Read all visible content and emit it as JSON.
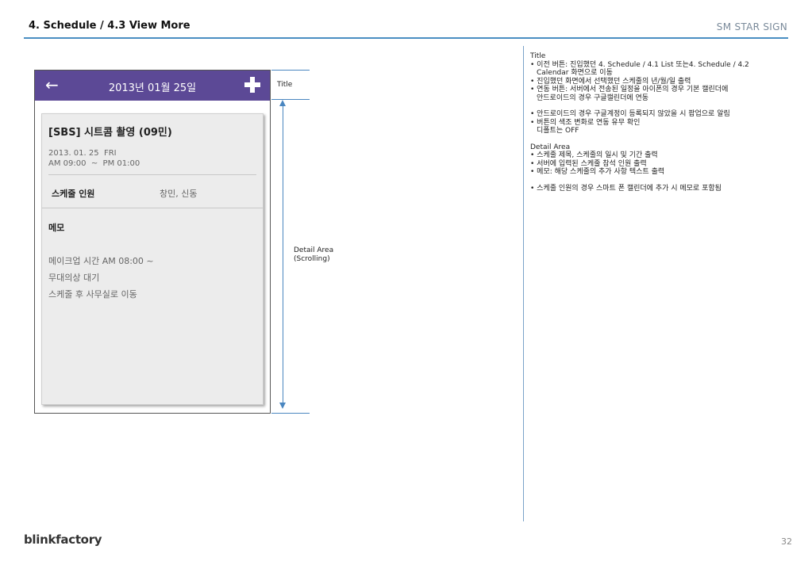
{
  "document": {
    "title": "4. Schedule / 4.3 View More",
    "brand": "SM STAR SIGN",
    "footer_logo": "blinkfactory",
    "page_number": "32"
  },
  "app": {
    "header": {
      "date": "2013년 01월 25일",
      "back_icon": "arrow-left-icon",
      "add_icon": "plus-icon"
    },
    "schedule": {
      "title": "[SBS] 시트콤 촬영 (09민)",
      "date_line": "2013. 01. 25  FRI",
      "time_line": "AM 09:00  ~  PM 01:00",
      "members_label": "스케줄 인원",
      "members_value": "창민, 신동",
      "memo_label": "메모",
      "memo_lines": [
        "메이크업 시간  AM 08:00 ~",
        "무대의상 대기",
        "스케줄 후 사무실로 이동"
      ]
    },
    "colors": {
      "header_bg": "#5c4996",
      "accent": "#4a8ec2"
    }
  },
  "annotations": {
    "title_label": "Title",
    "detail_label_1": "Detail Area",
    "detail_label_2": "(Scrolling)"
  },
  "notes": {
    "title_section": "Title",
    "b1": "• 이전 버튼: 진입했던  4. Schedule / 4.1 List 또는4. Schedule / 4.2",
    "b1_cont": "Calendar 화면으로 이동",
    "b2": "• 진입했던 화면에서 선택했던 스케줄의 년/월/일 출력",
    "b3": "• 연동 버튼: 서버에서 전송된 일정을 아이폰의 경우 기본 캘린더에",
    "b3_cont": "안드로이드의 경우 구글캘린더에 연동",
    "b4": "• 안드로이드의 경우 구글계정이 등록되지 않았을 시 팝업으로 알림",
    "b5": "• 버튼의 색조 변화로 연동 유무 확인",
    "b5_cont": "디폴트는 OFF",
    "detail_section": "Detail Area",
    "d1": "• 스케줄 제목, 스케줄의 일시 및 기간 출력",
    "d2": "• 서버에 입력된 스케줄 참석 인원 출력",
    "d3": "• 메모: 해당 스케줄의 추가 사항 텍스트 출력",
    "d4": "• 스케줄 인원의 경우 스마트 폰 캘린더에 추가 시 메모로 포함됨"
  }
}
